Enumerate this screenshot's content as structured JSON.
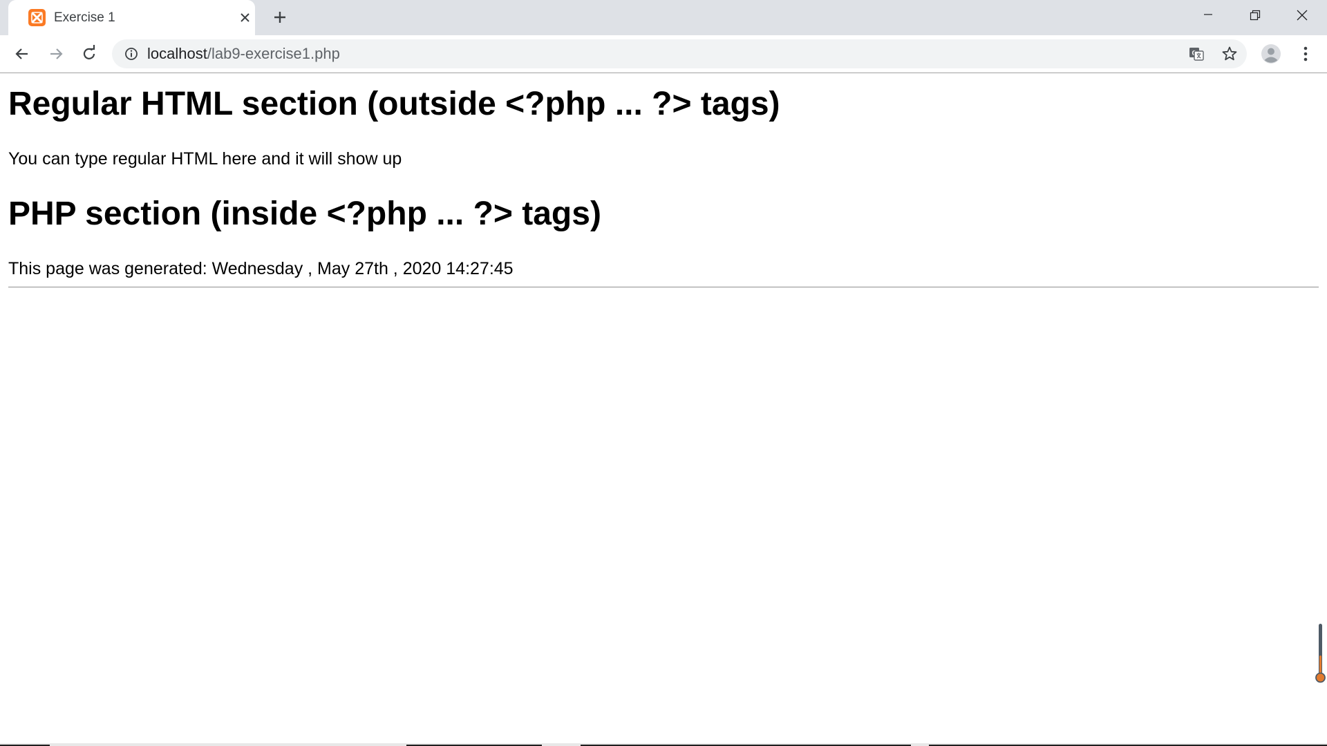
{
  "browser": {
    "tab": {
      "title": "Exercise 1",
      "favicon": "xampp-icon"
    },
    "new_tab_icon": "plus-icon",
    "window_controls": [
      "minimize-icon",
      "restore-icon",
      "close-icon"
    ],
    "toolbar": {
      "back_icon": "arrow-left-icon",
      "forward_icon": "arrow-right-icon",
      "reload_icon": "reload-icon",
      "site_info_icon": "info-icon",
      "url_host": "localhost",
      "url_path": "/lab9-exercise1.php",
      "translate_icon": "translate-icon",
      "bookmark_icon": "star-icon",
      "profile_icon": "avatar-icon",
      "menu_icon": "kebab-menu-icon"
    },
    "colors": {
      "tabstrip": "#dee1e6",
      "omnibox": "#f1f3f4",
      "favicon": "#fb7a24"
    }
  },
  "page": {
    "heading_html": "Regular HTML section (outside <?php ... ?> tags)",
    "html_text": "You can type regular HTML here and it will show up",
    "heading_php": "PHP section (inside <?php ... ?> tags)",
    "generated_text": "This page was generated: Wednesday , May 27th , 2020 14:27:45"
  }
}
